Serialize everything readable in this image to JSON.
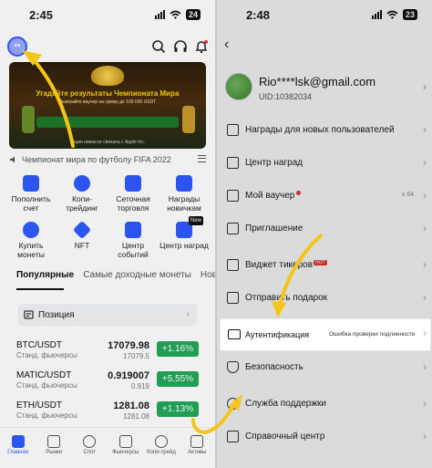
{
  "left": {
    "status": {
      "time": "2:45",
      "battery": "24"
    },
    "avatar_glyph": "••",
    "banner": {
      "headline": "Угадайте результаты Чемпионата Мира",
      "subline": "Выиграйте ваучер на сумму до 100 000 USDT",
      "disclaimer": "Акция никак не связана с Apple Inc."
    },
    "news": "Чемпионат мира по футболу FIFA 2022",
    "quick_actions": [
      {
        "label": "Пополнить счет",
        "icon": "deposit-icon",
        "color": "#2f5bff"
      },
      {
        "label": "Копи-трейдинг",
        "icon": "copy-trading-icon",
        "color": "#2f5bff"
      },
      {
        "label": "Сеточная торговля",
        "icon": "grid-trading-icon",
        "color": "#2f5bff"
      },
      {
        "label": "Награды новичкам",
        "icon": "gift-icon",
        "color": "#2f5bff"
      },
      {
        "label": "Купить монеты",
        "icon": "buy-crypto-icon",
        "color": "#2f5bff"
      },
      {
        "label": "NFT",
        "icon": "nft-icon",
        "color": "#2f5bff"
      },
      {
        "label": "Центр событий",
        "icon": "event-center-icon",
        "color": "#2f5bff"
      },
      {
        "label": "Центр наград",
        "icon": "rewards-center-icon",
        "color": "#2f5bff",
        "badge": "New"
      }
    ],
    "tabs": [
      "Популярные",
      "Самые доходные монеты",
      "Новые"
    ],
    "tab_more": "Новые а",
    "positions_label": "Позиция",
    "markets": [
      {
        "symbol": "BTC/USDT",
        "type": "Станд. фьючерсы",
        "price": "17079.98",
        "price2": "17079.5",
        "change": "+1.16%"
      },
      {
        "symbol": "MATIC/USDT",
        "type": "Станд. фьючерсы",
        "price": "0.919007",
        "price2": "0.919",
        "change": "+5.55%"
      },
      {
        "symbol": "ETH/USDT",
        "type": "Станд. фьючерсы",
        "price": "1281.08",
        "price2": "1281.08",
        "change": "+1.13%"
      }
    ],
    "nav": [
      {
        "label": "Главная",
        "active": true
      },
      {
        "label": "Рынки",
        "active": false
      },
      {
        "label": "Спот",
        "active": false
      },
      {
        "label": "Фьючерсы",
        "active": false
      },
      {
        "label": "Копи-трейд",
        "active": false
      },
      {
        "label": "Активы",
        "active": false
      }
    ],
    "colors": {
      "accent": "#2f5bff",
      "green": "#21a85a",
      "arrow": "#f5c518"
    }
  },
  "right": {
    "status": {
      "time": "2:48",
      "battery": "23"
    },
    "email": "Rio****lsk@gmail.com",
    "uid": "UID:10382034",
    "menu": [
      {
        "label": "Награды для новых пользователей",
        "icon": "new-user-rewards-icon"
      },
      {
        "label": "Центр наград",
        "icon": "rewards-center-icon"
      },
      {
        "label": "Мой ваучер",
        "icon": "voucher-icon",
        "dot": true,
        "value": "x 64"
      },
      {
        "label": "Приглашение",
        "icon": "invite-icon"
      },
      {
        "label": "Виджет тикеров",
        "icon": "ticker-widget-icon",
        "hot": "HOT"
      },
      {
        "label": "Отправить подарок",
        "icon": "gift-send-icon"
      },
      {
        "label": "Аутентификация",
        "icon": "id-card-icon",
        "value": "Ошибка проверки подлинности",
        "highlight": true
      },
      {
        "label": "Безопасность",
        "icon": "shield-icon"
      },
      {
        "label": "Служба поддержки",
        "icon": "support-icon"
      },
      {
        "label": "Справочный центр",
        "icon": "help-center-icon"
      }
    ]
  }
}
